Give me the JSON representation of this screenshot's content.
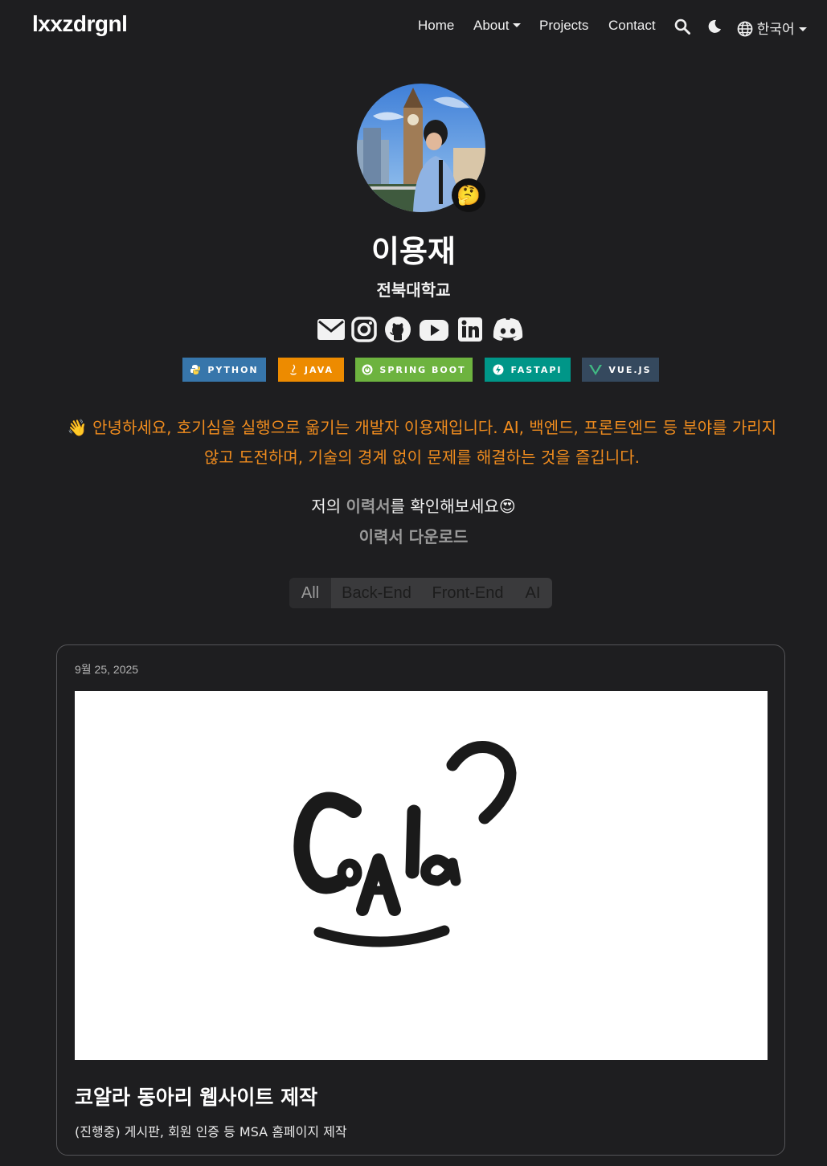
{
  "nav": {
    "brand": "lxxzdrgnl",
    "home": "Home",
    "about": "About",
    "projects": "Projects",
    "contact": "Contact",
    "language": "한국어",
    "icons": [
      "search-icon",
      "moon-icon",
      "globe-icon"
    ]
  },
  "profile": {
    "avatar": "profile-photo",
    "status_emoji": "🤔",
    "name": "이용재",
    "affiliation": "전북대학교",
    "social_icons": [
      "email-icon",
      "instagram-icon",
      "github-icon",
      "youtube-icon",
      "linkedin-icon",
      "discord-icon"
    ]
  },
  "badges": [
    {
      "label": "PYTHON",
      "color": "#3776ab",
      "icon": "python-icon"
    },
    {
      "label": "JAVA",
      "color": "#ed8b00",
      "icon": "java-icon"
    },
    {
      "label": "SPRING BOOT",
      "color": "#6db33f",
      "icon": "spring-icon"
    },
    {
      "label": "FASTAPI",
      "color": "#009688",
      "icon": "fastapi-icon"
    },
    {
      "label": "VUE.JS",
      "color": "#35495e",
      "icon": "vue-icon"
    }
  ],
  "intro": {
    "emoji": "👋",
    "text": "안녕하세요, 호기심을 실행으로 옮기는 개발자 이용재입니다. AI, 백엔드, 프론트엔드 등 분야를 가리지 않고 도전하며, 기술의 경계 없이 문제를 해결하는 것을 즐깁니다."
  },
  "cv": {
    "prefix": "저의 ",
    "link": "이력서",
    "suffix": "를 확인해보세요",
    "emoji": "😍",
    "download": "이력서 다운로드"
  },
  "filters": [
    "All",
    "Back-End",
    "Front-End",
    "AI"
  ],
  "active_filter": "All",
  "project": {
    "date": "9월 25, 2025",
    "title": "코알라 동아리 웹사이트 제작",
    "description": "(진행중) 게시판, 회원 인증 등 MSA 홈페이지 제작",
    "image": "coala-logo"
  }
}
